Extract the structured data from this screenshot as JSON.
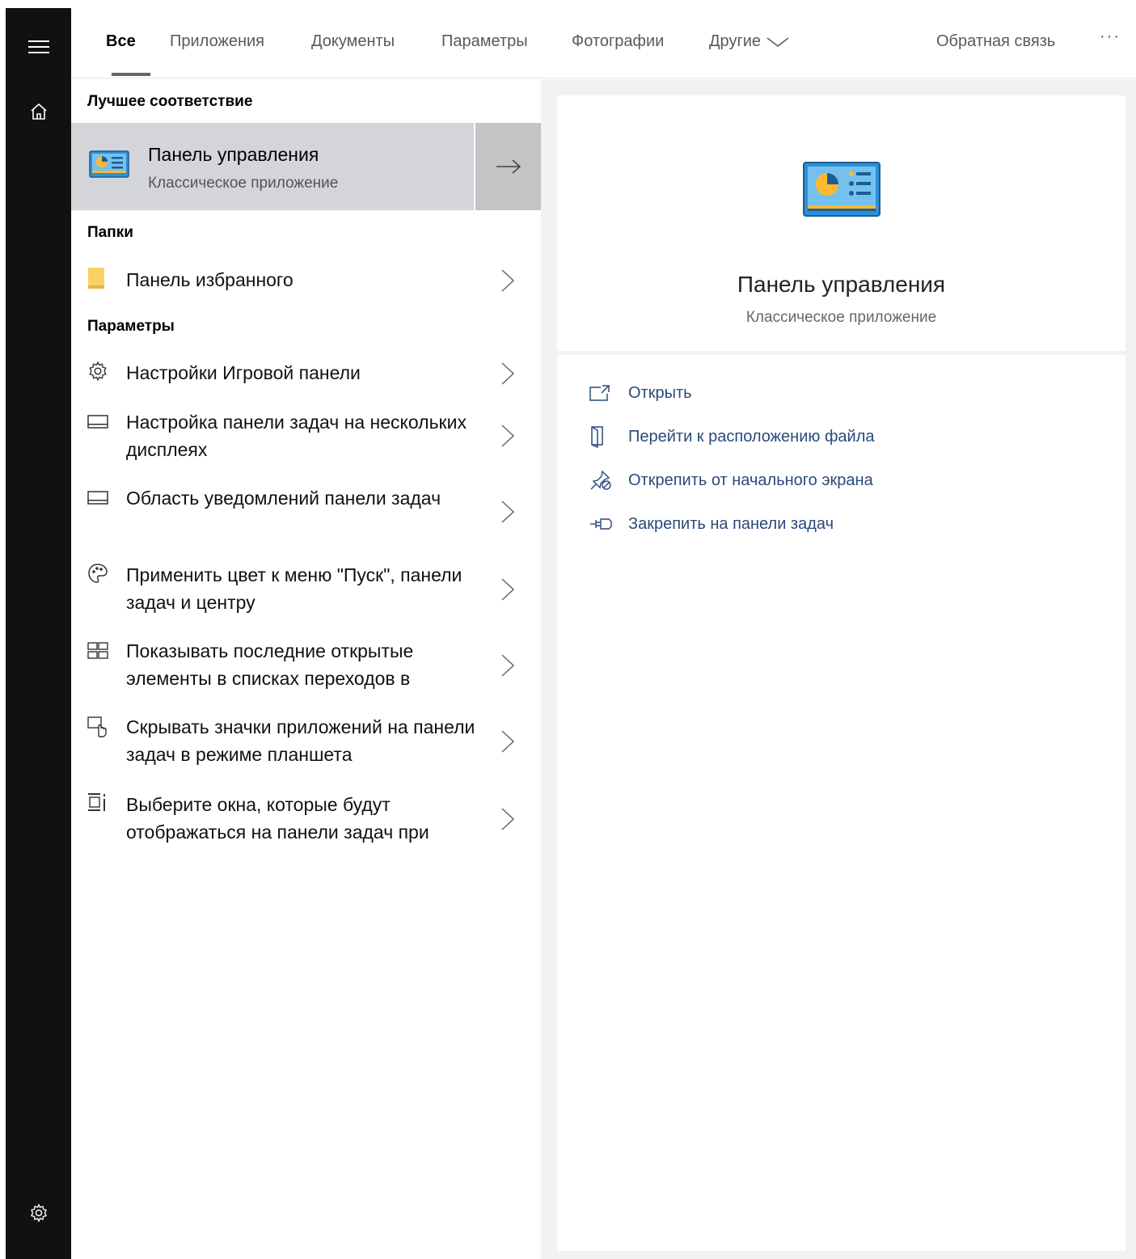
{
  "tabs": {
    "all": "Все",
    "apps": "Приложения",
    "documents": "Документы",
    "settings": "Параметры",
    "photos": "Фотографии",
    "other": "Другие",
    "feedback": "Обратная связь",
    "more": "···"
  },
  "rail": {
    "menu_icon": "hamburger-icon",
    "home_icon": "home-icon",
    "settings_icon": "gear-icon"
  },
  "best_match": {
    "heading": "Лучшее соответствие",
    "title": "Панель управления",
    "subtitle": "Классическое приложение",
    "icon": "control-panel-icon"
  },
  "folders": {
    "heading": "Папки",
    "items": [
      {
        "label": "Панель избранного",
        "icon": "folder-icon"
      }
    ]
  },
  "settings": {
    "heading": "Параметры",
    "items": [
      {
        "label": "Настройки Игровой панели",
        "icon": "gear-icon"
      },
      {
        "label": "Настройка панели задач на нескольких дисплеях",
        "icon": "taskbar-icon"
      },
      {
        "label": "Область уведомлений панели задач",
        "icon": "taskbar-icon"
      },
      {
        "label": "Применить цвет к меню \"Пуск\", панели задач и центру",
        "icon": "palette-icon"
      },
      {
        "label": "Показывать последние открытые элементы в списках переходов в",
        "icon": "start-layout-icon"
      },
      {
        "label": "Скрывать значки приложений на панели задач в режиме планшета",
        "icon": "tablet-mode-icon"
      },
      {
        "label": "Выберите окна, которые будут отображаться на панели задач при",
        "icon": "window-select-icon"
      }
    ]
  },
  "preview": {
    "title": "Панель управления",
    "subtitle": "Классическое приложение",
    "actions": [
      {
        "label": "Открыть",
        "icon": "open-icon"
      },
      {
        "label": "Перейти к расположению файла",
        "icon": "file-location-icon"
      },
      {
        "label": "Открепить от начального экрана",
        "icon": "unpin-icon"
      },
      {
        "label": "Закрепить на панели задач",
        "icon": "pin-icon"
      }
    ]
  },
  "colors": {
    "rail": "#111111",
    "selected_row": "#d4d5d8",
    "selected_arrow": "#c3c4c6",
    "pane_bg": "#f2f2f2",
    "action_text": "#2a4a7a"
  }
}
